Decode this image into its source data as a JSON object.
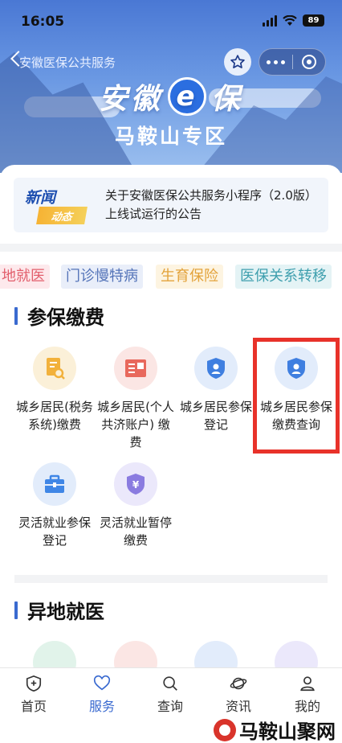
{
  "status": {
    "time": "16:05",
    "battery": "89"
  },
  "header": {
    "title": "安徽医保公共服务",
    "brand_left": "安徽",
    "brand_e": "e",
    "brand_right": "保",
    "district": "马鞍山专区"
  },
  "news": {
    "badge_top": "新闻",
    "badge_bottom": "动态",
    "text": "关于安徽医保公共服务小程序（2.0版） 上线试运行的公告"
  },
  "tags": [
    "地就医",
    "门诊慢特病",
    "生育保险",
    "医保关系转移"
  ],
  "section1": {
    "title": "参保缴费",
    "services": [
      {
        "label": "城乡居民(税务系统)缴费"
      },
      {
        "label": "城乡居民(个人共济账户) 缴费"
      },
      {
        "label": "城乡居民参保登记"
      },
      {
        "label": "城乡居民参保缴费查询"
      },
      {
        "label": "灵活就业参保登记"
      },
      {
        "label": "灵活就业暂停缴费"
      }
    ]
  },
  "section2": {
    "title": "异地就医"
  },
  "tabbar": [
    "首页",
    "服务",
    "查询",
    "资讯",
    "我的"
  ],
  "watermark": "马鞍山聚网",
  "colors": {
    "accent": "#3a6ad0",
    "highlight": "#e8322a"
  }
}
